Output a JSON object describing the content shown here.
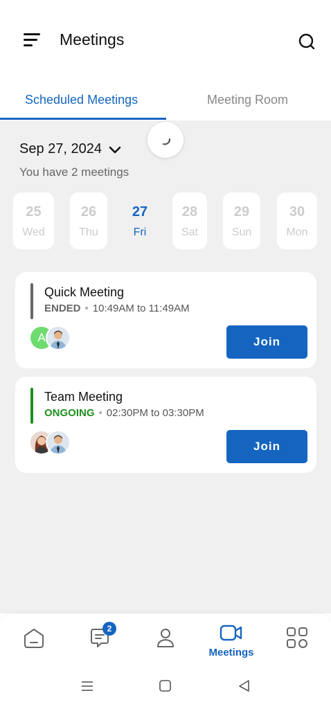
{
  "header": {
    "title": "Meetings"
  },
  "tabs": [
    {
      "label": "Scheduled Meetings",
      "active": true
    },
    {
      "label": "Meeting Room",
      "active": false
    }
  ],
  "date_selector": {
    "date": "Sep 27, 2024",
    "summary": "You have 2 meetings"
  },
  "days": [
    {
      "num": "25",
      "dow": "Wed"
    },
    {
      "num": "26",
      "dow": "Thu"
    },
    {
      "num": "27",
      "dow": "Fri",
      "active": true
    },
    {
      "num": "28",
      "dow": "Sat"
    },
    {
      "num": "29",
      "dow": "Sun"
    },
    {
      "num": "30",
      "dow": "Mon"
    }
  ],
  "meetings": [
    {
      "title": "Quick Meeting",
      "status": "ENDED",
      "time": "10:49AM to 11:49AM",
      "status_color": "#666666",
      "bar_color": "#666666",
      "join_label": "Join",
      "avatar_initial": "A"
    },
    {
      "title": "Team Meeting",
      "status": "ONGOING",
      "time": "02:30PM to 03:30PM",
      "status_color": "#1e8e1e",
      "bar_color": "#1e8e1e",
      "join_label": "Join"
    }
  ],
  "bottom_nav": {
    "chat_badge": "2",
    "active_label": "Meetings"
  },
  "colors": {
    "accent": "#1565c0",
    "ongoing": "#1e8e1e",
    "ended": "#666666"
  }
}
